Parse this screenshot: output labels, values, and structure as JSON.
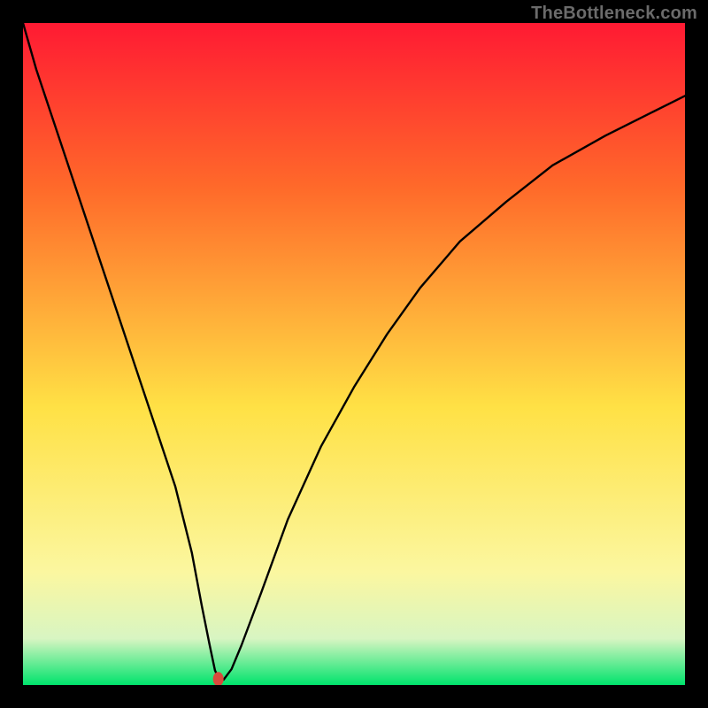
{
  "watermark": "TheBottleneck.com",
  "chart_data": {
    "type": "line",
    "title": "",
    "xlabel": "",
    "ylabel": "",
    "xlim": [
      0,
      100
    ],
    "ylim": [
      0,
      100
    ],
    "grid": false,
    "gradient_colors": {
      "top": "#ff1a33",
      "mid_top": "#ff6a2a",
      "mid": "#ffe145",
      "mid_low": "#fbf7a0",
      "low": "#d8f5c2",
      "bottom": "#00e36c"
    },
    "series": [
      {
        "name": "bottleneck-curve",
        "color": "#000000",
        "x": [
          0,
          2,
          5,
          8,
          11,
          14,
          17,
          20,
          23,
          25.5,
          27,
          28.2,
          29,
          29.7,
          30.3,
          31.5,
          33,
          36,
          40,
          45,
          50,
          55,
          60,
          66,
          73,
          80,
          88,
          95,
          100
        ],
        "values": [
          100,
          93,
          84,
          75,
          66,
          57,
          48,
          39,
          30,
          20,
          12,
          6,
          2.2,
          0.8,
          0.8,
          2.4,
          6,
          14,
          25,
          36,
          45,
          53,
          60,
          67,
          73,
          78.5,
          83,
          86.5,
          89
        ]
      }
    ],
    "marker": {
      "name": "min-point",
      "x": 29.5,
      "y": 0.9,
      "color": "#d84a3c",
      "rx": 6,
      "ry": 8
    }
  }
}
